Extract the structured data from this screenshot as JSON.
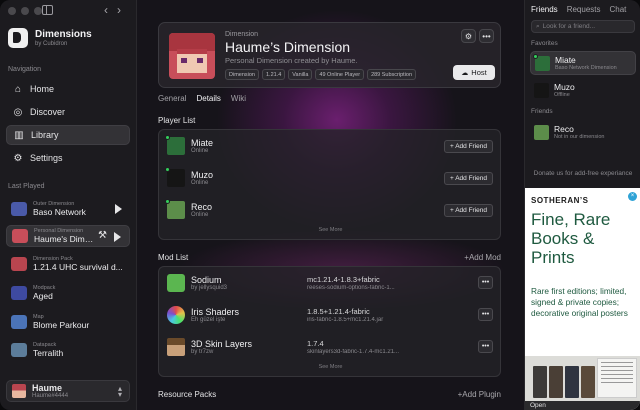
{
  "window": {
    "nav_back": "‹",
    "nav_forward": "›"
  },
  "app": {
    "name": "Dimensions",
    "by": "by Cubidron"
  },
  "sidebar": {
    "navigation_label": "Navigation",
    "nav": [
      {
        "label": "Home",
        "icon": "house-icon"
      },
      {
        "label": "Discover",
        "icon": "compass-icon"
      },
      {
        "label": "Library",
        "icon": "library-icon",
        "active": true
      },
      {
        "label": "Settings",
        "icon": "gear-icon"
      }
    ],
    "last_played_label": "Last Played",
    "recent": [
      {
        "kind": "Outer Dimension",
        "name": "Baso Network",
        "thumb": "#4a5aa8",
        "play": true
      },
      {
        "kind": "Personal Dimension",
        "name": "Haume's Dimension",
        "thumb": "#c84e5a",
        "play": true,
        "tool": true,
        "active": true
      },
      {
        "kind": "Dimension Pack",
        "name": "1.21.4 UHC survival d...",
        "thumb": "#b8454f"
      },
      {
        "kind": "Modpack",
        "name": "Aged",
        "thumb": "#3e4aa0"
      },
      {
        "kind": "Map",
        "name": "Blome Parkour",
        "thumb": "#4b74b8"
      },
      {
        "kind": "Datapack",
        "name": "Terralith",
        "thumb": "#5c7d9a"
      }
    ],
    "account": {
      "name": "Haume",
      "tag": "Haume#4444"
    }
  },
  "hero": {
    "kind": "Dimension",
    "title": "Haume’s Dimension",
    "description": "Personal Dimension created by Haume.",
    "chips": [
      "Dimension",
      "1.21.4",
      "Vanilla",
      "49 Online Player",
      "289 Subscription"
    ],
    "gear_icon": "gear-icon",
    "more_label": "•••",
    "host_label": "Host"
  },
  "tabs": [
    {
      "label": "General"
    },
    {
      "label": "Details",
      "active": true
    },
    {
      "label": "Wiki"
    }
  ],
  "player_list": {
    "title": "Player List",
    "players": [
      {
        "name": "Miate",
        "status": "Online",
        "skin": "#2c6e3a",
        "action": "+ Add Friend"
      },
      {
        "name": "Muzo",
        "status": "Online",
        "skin": "#151515",
        "action": "+ Add Friend"
      },
      {
        "name": "Reco",
        "status": "Online",
        "skin": "#5c8d4a",
        "action": "+ Add Friend"
      }
    ],
    "see_more": "See More"
  },
  "mod_list": {
    "title": "Mod List",
    "add_label": "+Add Mod",
    "mods": [
      {
        "name": "Sodium",
        "author": "by jellysquid3",
        "version": "mc1.21.4-1.8.3+fabric",
        "file": "reeses-sodium-options-fabric-1...",
        "icon_color": "#5bb650"
      },
      {
        "name": "Iris Shaders",
        "author": "Eh güzel işte",
        "version": "1.8.5+1.21.4-fabric",
        "file": "iris-fabric-1.8.5+mc1.21.4.jar",
        "icon_color": "#7a4fd0"
      },
      {
        "name": "3D Skin Layers",
        "author": "by tr7zw",
        "version": "1.7.4",
        "file": "skinlayers3d-fabric-1.7.4-mc1.21...",
        "icon_color": "#a47a4a"
      }
    ],
    "see_more": "See More",
    "more_label": "•••"
  },
  "resource_packs": {
    "title": "Resource Packs",
    "add_label": "+Add Plugin"
  },
  "friends_panel": {
    "tabs": [
      {
        "label": "Friends",
        "active": true
      },
      {
        "label": "Requests"
      },
      {
        "label": "Chat"
      }
    ],
    "search_placeholder": "Look for a friend...",
    "favorites_label": "Favorites",
    "favorites": [
      {
        "name": "Miate",
        "status": "Baso Network Dimension",
        "skin": "#2c6e3a",
        "online": true,
        "active": true
      },
      {
        "name": "Muzo",
        "status": "Offline",
        "skin": "#151515",
        "online": false
      }
    ],
    "friends_label": "Friends",
    "friends": [
      {
        "name": "Reco",
        "status": "Not in our dimension",
        "skin": "#5c8d4a",
        "online": false
      }
    ],
    "donate_text": "Donate us for add-free experiance"
  },
  "ad": {
    "brand": "SOTHERAN’S",
    "headline": "Fine, Rare Books & Prints",
    "body": "Rare first editions; limited, signed & private copies; decorative original posters",
    "open_label": "Open",
    "close_label": "×"
  }
}
